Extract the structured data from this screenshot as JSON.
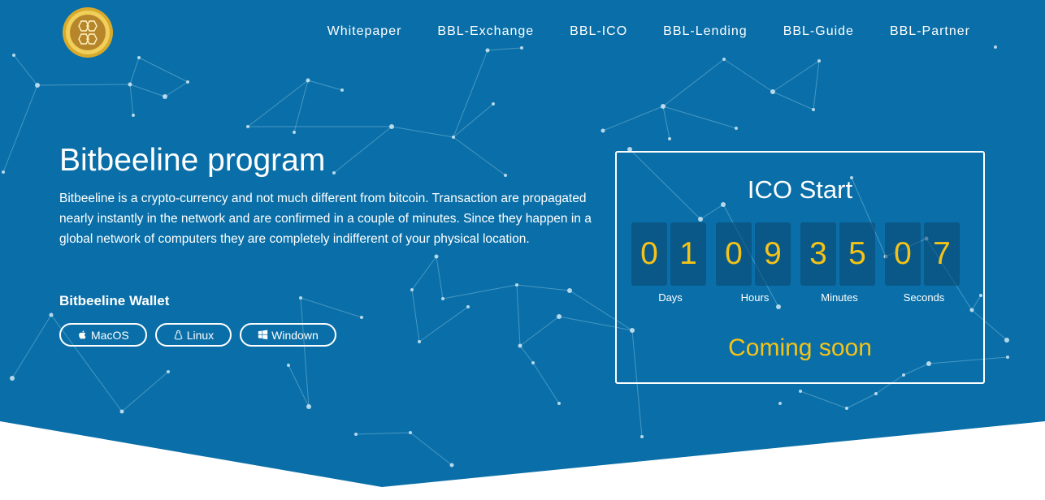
{
  "nav": {
    "items": [
      "Whitepaper",
      "BBL-Exchange",
      "BBL-ICO",
      "BBL-Lending",
      "BBL-Guide",
      "BBL-Partner"
    ]
  },
  "hero": {
    "title": "Bitbeeline program",
    "description": "Bitbeeline is a crypto-currency and not much different from bitcoin. Transaction are propagated nearly instantly in the network and are confirmed in a couple of minutes. Since they happen in a global network of computers they are completely indifferent of your physical location."
  },
  "wallet": {
    "title": "Bitbeeline Wallet",
    "buttons": [
      {
        "label": "MacOS",
        "icon": "apple-icon"
      },
      {
        "label": "Linux",
        "icon": "linux-icon"
      },
      {
        "label": "Windown",
        "icon": "windows-icon"
      }
    ]
  },
  "ico": {
    "title": "ICO Start",
    "digits": [
      "0",
      "1",
      "0",
      "9",
      "3",
      "5",
      "0",
      "7"
    ],
    "units": [
      "Days",
      "Hours",
      "Minutes",
      "Seconds"
    ],
    "status": "Coming soon"
  },
  "colors": {
    "background": "#0a6fa8",
    "accent": "#f5c318",
    "text": "#ffffff"
  }
}
